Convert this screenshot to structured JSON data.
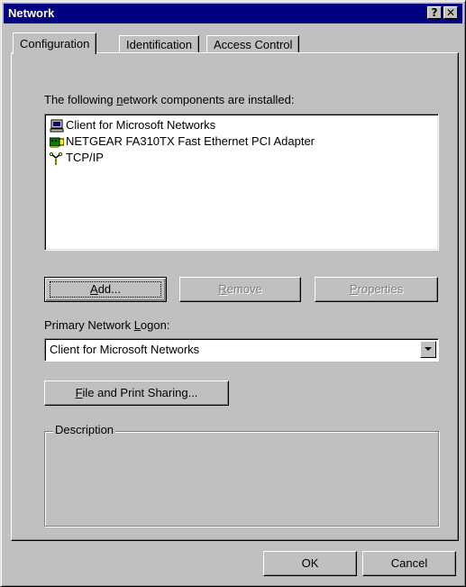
{
  "window": {
    "title": "Network",
    "help_button": "?",
    "close_button": "✕"
  },
  "tabs": [
    {
      "label": "Configuration"
    },
    {
      "label": "Identification"
    },
    {
      "label": "Access Control"
    }
  ],
  "components": {
    "label_pre": "The following ",
    "label_accel": "n",
    "label_post": "etwork components are installed:",
    "items": [
      {
        "label": "Client for Microsoft Networks",
        "icon": "network-client-icon"
      },
      {
        "label": "NETGEAR FA310TX Fast Ethernet PCI Adapter",
        "icon": "network-adapter-icon"
      },
      {
        "label": "TCP/IP",
        "icon": "protocol-icon"
      }
    ]
  },
  "buttons": {
    "add_accel": "A",
    "add_rest": "dd...",
    "remove_accel": "R",
    "remove_rest": "emove",
    "properties_accel": "P",
    "properties_rest": "roperties",
    "file_print_accel": "F",
    "file_print_rest": "ile and Print Sharing...",
    "ok": "OK",
    "cancel": "Cancel"
  },
  "logon": {
    "label_pre": "Primary Network ",
    "label_accel": "L",
    "label_post": "ogon:",
    "value": "Client for Microsoft Networks"
  },
  "description": {
    "legend": "Description"
  },
  "colors": {
    "titlebar": "#000080",
    "face": "#c0c0c0"
  }
}
